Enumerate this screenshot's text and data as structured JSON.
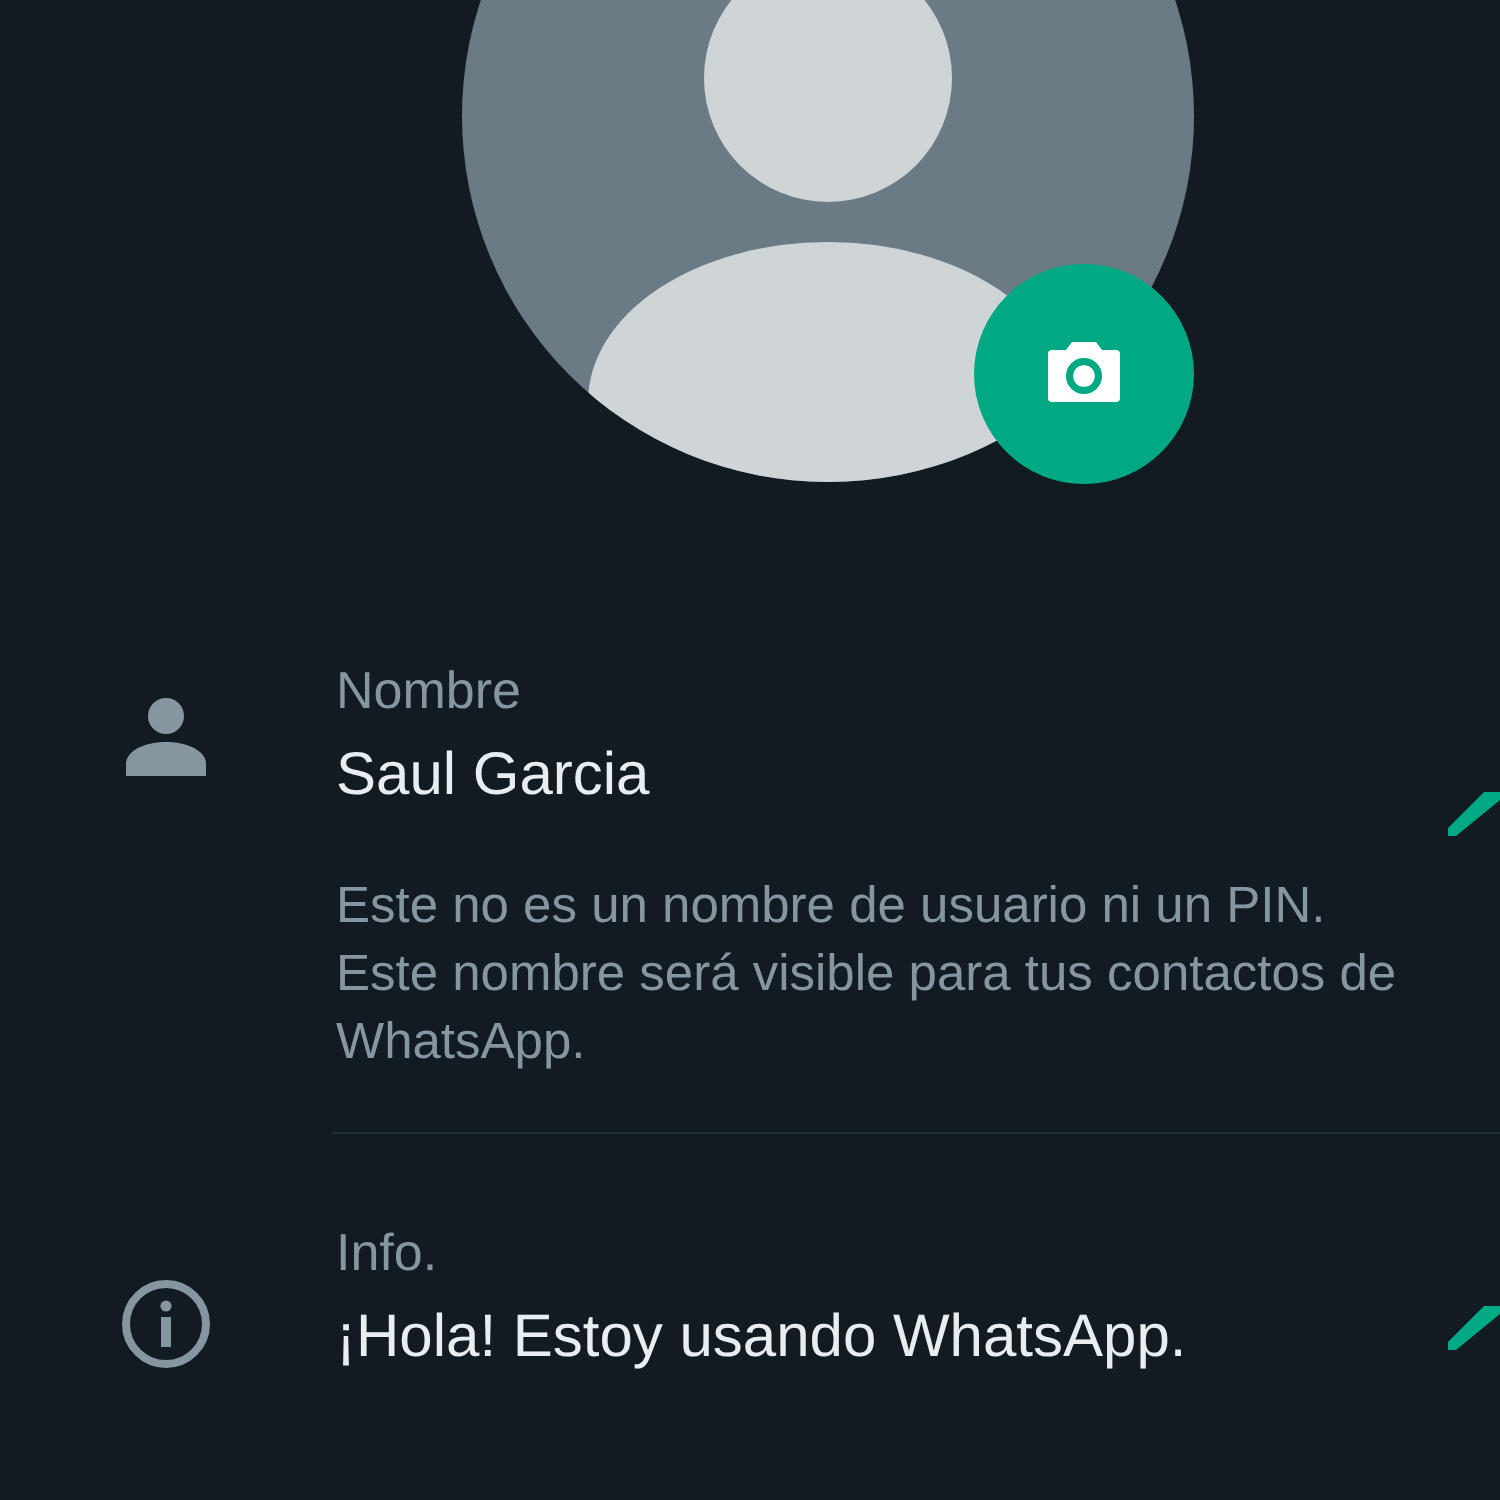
{
  "fields": [
    {
      "kind": "name",
      "label": "Nombre",
      "value": "Saul Garcia",
      "hint": "Este no es un nombre de usuario ni un PIN. Este nombre será visible para tus contactos de WhatsApp."
    },
    {
      "kind": "info",
      "label": "Info.",
      "value": "¡Hola! Estoy usando WhatsApp."
    }
  ]
}
